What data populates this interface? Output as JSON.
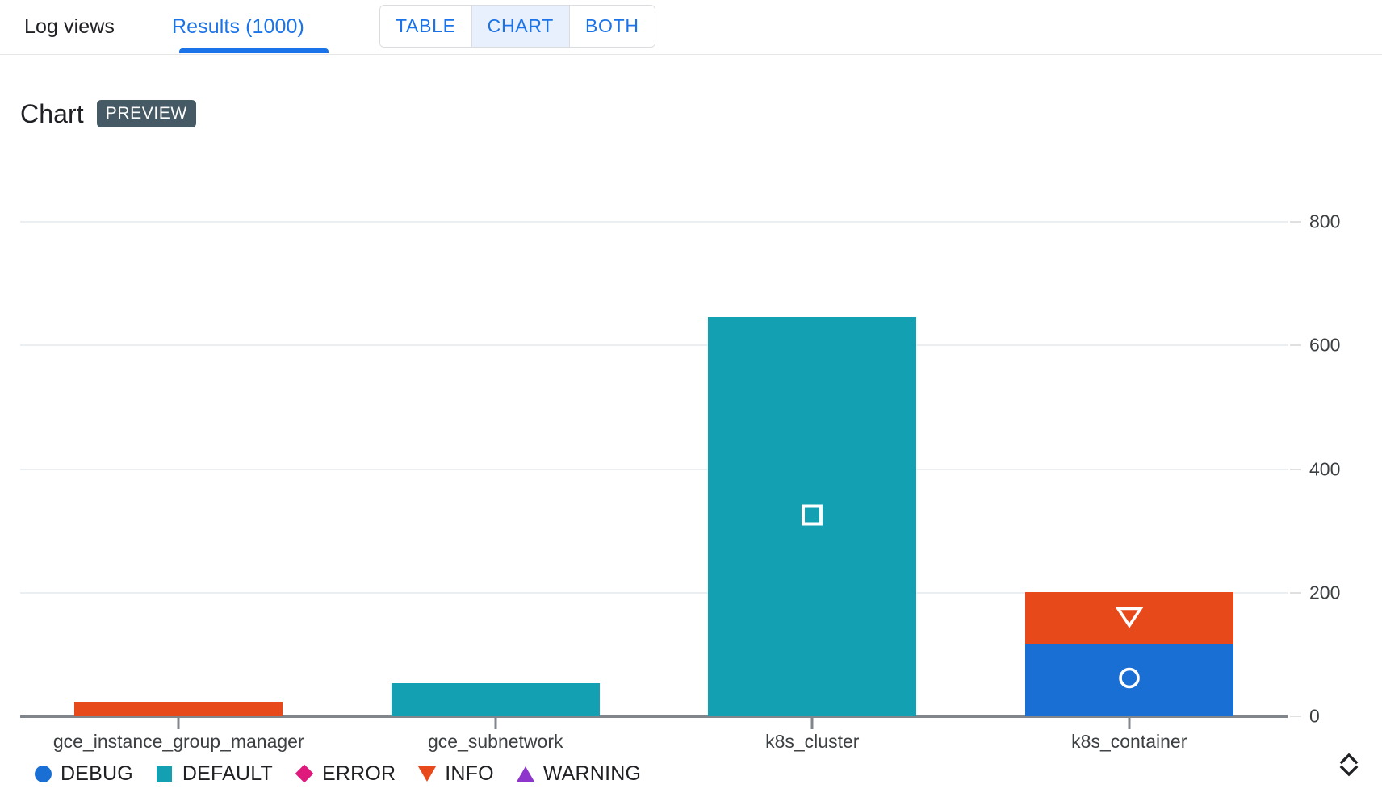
{
  "tabs": [
    {
      "id": "log-views",
      "label": "Log views",
      "selected": false
    },
    {
      "id": "results",
      "label": "Results (1000)",
      "selected": true
    }
  ],
  "view_toggle": {
    "options": [
      {
        "id": "table",
        "label": "TABLE",
        "selected": false
      },
      {
        "id": "chart",
        "label": "CHART",
        "selected": true
      },
      {
        "id": "both",
        "label": "BOTH",
        "selected": false
      }
    ]
  },
  "chart_header": {
    "title": "Chart",
    "badge": "PREVIEW"
  },
  "expand_control": {
    "icon": "expand-collapse-chevrons-icon"
  },
  "colors": {
    "accent_blue": "#1a73e8",
    "toggle_selected_bg": "#e8f0fe",
    "badge_bg": "#455a64",
    "axis": "#80868b",
    "gridline": "#eceff1",
    "debug": "#1a6fd4",
    "default": "#13a0b2",
    "error": "#e0197d",
    "info": "#e8491b",
    "warning": "#8e36cc"
  },
  "chart_data": {
    "type": "bar",
    "title": "Chart",
    "stacked": true,
    "xlabel": "",
    "ylabel": "",
    "ylim": [
      0,
      850
    ],
    "yticks": [
      0,
      200,
      400,
      600,
      800
    ],
    "grid": true,
    "legend_position": "bottom-left",
    "categories": [
      "gce_instance_group_manager",
      "gce_subnetwork",
      "k8s_cluster",
      "k8s_container"
    ],
    "series": [
      {
        "name": "DEBUG",
        "color": "#1a6fd4",
        "marker": "circle",
        "values": [
          0,
          0,
          0,
          118
        ]
      },
      {
        "name": "DEFAULT",
        "color": "#13a0b2",
        "marker": "square",
        "values": [
          0,
          54,
          646,
          0
        ]
      },
      {
        "name": "ERROR",
        "color": "#e0197d",
        "marker": "diamond",
        "values": [
          0,
          0,
          0,
          0
        ]
      },
      {
        "name": "INFO",
        "color": "#e8491b",
        "marker": "triangle-down",
        "values": [
          23,
          0,
          0,
          83
        ]
      },
      {
        "name": "WARNING",
        "color": "#8e36cc",
        "marker": "triangle-up",
        "values": [
          0,
          0,
          0,
          0
        ]
      }
    ]
  },
  "legend": [
    {
      "label": "DEBUG",
      "color": "#1a6fd4",
      "glyph": "circle"
    },
    {
      "label": "DEFAULT",
      "color": "#13a0b2",
      "glyph": "square"
    },
    {
      "label": "ERROR",
      "color": "#e0197d",
      "glyph": "diamond"
    },
    {
      "label": "INFO",
      "color": "#e8491b",
      "glyph": "triangle-down"
    },
    {
      "label": "WARNING",
      "color": "#8e36cc",
      "glyph": "triangle-up"
    }
  ]
}
